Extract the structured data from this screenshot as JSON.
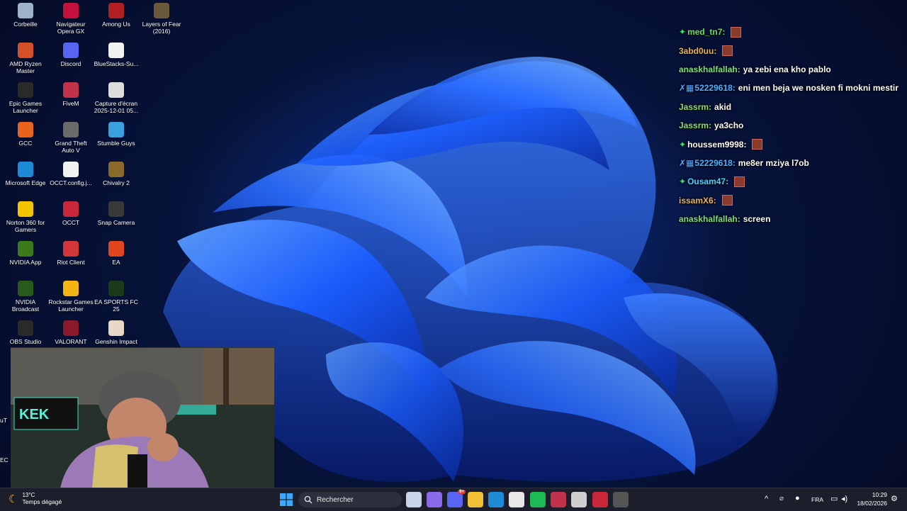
{
  "desktop": {
    "icons": [
      {
        "label": "Corbeille",
        "icon": "recycle-bin-icon",
        "color": "#9db3c8"
      },
      {
        "label": "Navigateur Opera GX",
        "icon": "opera-gx-icon",
        "color": "#c2123b"
      },
      {
        "label": "Among Us",
        "icon": "among-us-icon",
        "color": "#b02020"
      },
      {
        "label": "Layers of Fear (2016)",
        "icon": "layers-of-fear-icon",
        "color": "#6b5a3a"
      },
      {
        "label": "AMD Ryzen Master",
        "icon": "amd-ryzen-icon",
        "color": "#d4502a"
      },
      {
        "label": "Discord",
        "icon": "discord-icon",
        "color": "#5865f2"
      },
      {
        "label": "BlueStacks-Su...",
        "icon": "file-icon",
        "color": "#f2f2f2"
      },
      {
        "label": "Epic Games Launcher",
        "icon": "epic-games-icon",
        "color": "#2a2a2a"
      },
      {
        "label": "FiveM",
        "icon": "fivem-icon",
        "color": "#c0324a"
      },
      {
        "label": "Capture d'écran 2025-12-01 05...",
        "icon": "screenshot-file-icon",
        "color": "#dddddd"
      },
      {
        "label": "GCC",
        "icon": "gcc-icon",
        "color": "#e8641e"
      },
      {
        "label": "Grand Theft Auto V",
        "icon": "gta-v-icon",
        "color": "#6a6a6a"
      },
      {
        "label": "Stumble Guys",
        "icon": "stumble-guys-icon",
        "color": "#3aa0e0"
      },
      {
        "label": "Microsoft Edge",
        "icon": "edge-icon",
        "color": "#1d8ad6"
      },
      {
        "label": "OCCT.config.j...",
        "icon": "file-icon",
        "color": "#f2f2f2"
      },
      {
        "label": "Chivalry 2",
        "icon": "chivalry-icon",
        "color": "#8a6a2a"
      },
      {
        "label": "Norton 360 for Gamers",
        "icon": "norton-icon",
        "color": "#f2c500"
      },
      {
        "label": "OCCT",
        "icon": "occt-icon",
        "color": "#c8283a"
      },
      {
        "label": "Snap Camera",
        "icon": "snap-camera-icon",
        "color": "#3a3a3a"
      },
      {
        "label": "NVIDIA App",
        "icon": "nvidia-icon",
        "color": "#3a7a1a"
      },
      {
        "label": "Riot Client",
        "icon": "riot-icon",
        "color": "#d13639"
      },
      {
        "label": "EA",
        "icon": "ea-icon",
        "color": "#e0461e"
      },
      {
        "label": "NVIDIA Broadcast",
        "icon": "nvidia-broadcast-icon",
        "color": "#2a5a1a"
      },
      {
        "label": "Rockstar Games Launcher",
        "icon": "rockstar-icon",
        "color": "#f3b414"
      },
      {
        "label": "EA SPORTS FC 25",
        "icon": "ea-fc-icon",
        "color": "#1b3a1a"
      },
      {
        "label": "OBS Studio",
        "icon": "obs-icon",
        "color": "#2a2a2a"
      },
      {
        "label": "VALORANT",
        "icon": "valorant-icon",
        "color": "#8a1a2a"
      },
      {
        "label": "Genshin Impact",
        "icon": "genshin-icon",
        "color": "#e8d8c8"
      }
    ],
    "partial_labels": [
      "uT",
      "EC"
    ]
  },
  "chat": {
    "messages": [
      {
        "user": "med_tn7:",
        "badge": "green",
        "text": "",
        "emote": true,
        "user_color": "#5fe35f"
      },
      {
        "user": "3abd0uu:",
        "badge": "",
        "text": "",
        "emote": true,
        "user_color": "#e8b35a"
      },
      {
        "user": "anaskhalfallah:",
        "badge": "",
        "text": "ya zebi ena kho pablo",
        "emote": false,
        "user_color": "#7ae27a"
      },
      {
        "user": "52229618:",
        "badge": "blue",
        "text": "eni men beja we nosken fi mokni mestir",
        "emote": false,
        "user_color": "#4fb0ff"
      },
      {
        "user": "Jassrm:",
        "badge": "",
        "text": "akid",
        "emote": false,
        "user_color": "#86e06a"
      },
      {
        "user": "Jassrm:",
        "badge": "",
        "text": "ya3cho",
        "emote": false,
        "user_color": "#86e06a"
      },
      {
        "user": "houssem9998:",
        "badge": "green",
        "text": "",
        "emote": true,
        "user_color": "#ffffff"
      },
      {
        "user": "52229618:",
        "badge": "blue",
        "text": "me8er mziya l7ob",
        "emote": false,
        "user_color": "#4fb0ff"
      },
      {
        "user": "Ousam47:",
        "badge": "green",
        "text": "",
        "emote": true,
        "user_color": "#4fd0ff"
      },
      {
        "user": "issamX6:",
        "badge": "",
        "text": "",
        "emote": true,
        "user_color": "#e8b35a"
      },
      {
        "user": "anaskhalfallah:",
        "badge": "",
        "text": "screen",
        "emote": false,
        "user_color": "#7ae27a"
      }
    ]
  },
  "webcam": {
    "sign_text": "KEK"
  },
  "taskbar": {
    "weather": {
      "temp": "13°C",
      "desc": "Temps dégagé"
    },
    "search_placeholder": "Rechercher",
    "apps": [
      {
        "icon": "task-view-icon",
        "color": "#c8d4e8"
      },
      {
        "icon": "copilot-icon",
        "color": "#8a6ae8"
      },
      {
        "icon": "discord-icon",
        "color": "#5865f2",
        "badge": "9+"
      },
      {
        "icon": "file-explorer-icon",
        "color": "#f2c038"
      },
      {
        "icon": "edge-icon",
        "color": "#1d8ad6"
      },
      {
        "icon": "store-icon",
        "color": "#e8e8e8"
      },
      {
        "icon": "spotify-icon",
        "color": "#1db954"
      },
      {
        "icon": "fivem-icon",
        "color": "#c0324a"
      },
      {
        "icon": "obs-icon",
        "color": "#cfcfcf"
      },
      {
        "icon": "app-red-icon",
        "color": "#c8283a"
      },
      {
        "icon": "app-dark-icon",
        "color": "#555555"
      }
    ],
    "tray": {
      "lang": "FRA",
      "time": "10:29",
      "date": "18/02/2026"
    }
  },
  "colors": {
    "accent": "#0a5cff",
    "taskbar_bg": "#1c1f2b"
  }
}
